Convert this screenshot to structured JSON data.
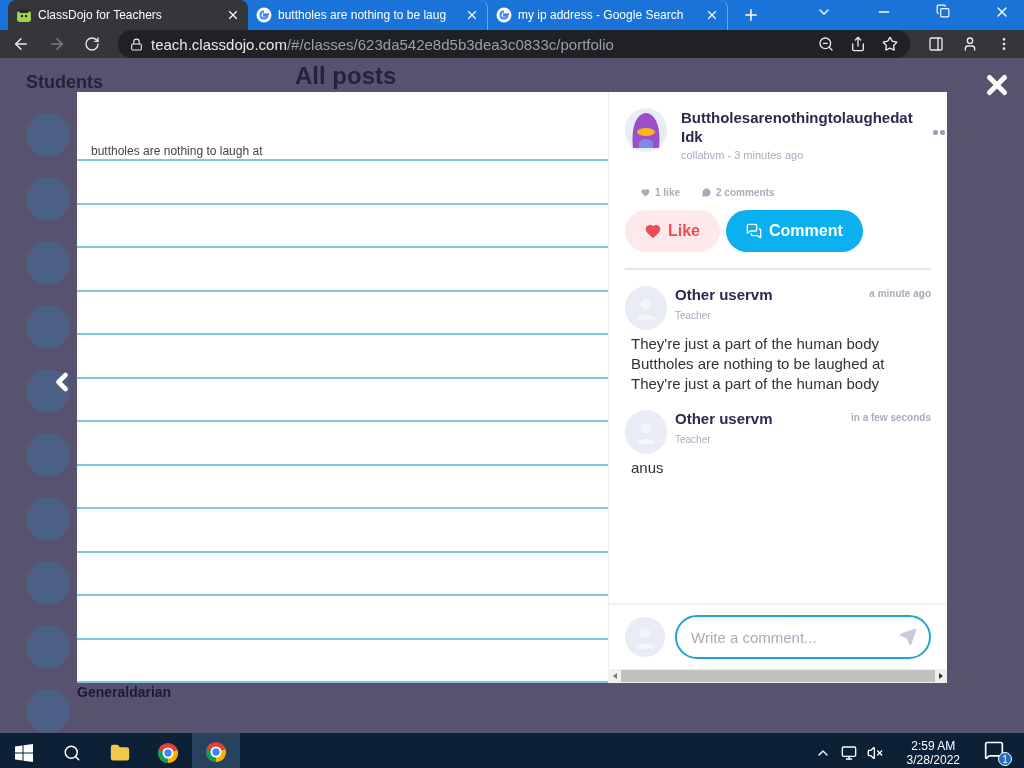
{
  "browser": {
    "tabs": [
      {
        "title": "ClassDojo for Teachers",
        "selected": true,
        "kind": "dojo"
      },
      {
        "title": "buttholes are nothing to be laug",
        "selected": false,
        "kind": "google"
      },
      {
        "title": "my ip address - Google Search",
        "selected": false,
        "kind": "google"
      }
    ],
    "url": {
      "host": "teach.classdojo.com",
      "path": "/#/classes/623da542e8d5b3dea3c0833c/portfolio"
    }
  },
  "background": {
    "sidebar_title": "Students",
    "heading": "All posts",
    "student_name": "Generaldarian"
  },
  "post": {
    "note": "buttholes are nothing to laugh at",
    "title": "Buttholesarenothingtolaughedat Idk",
    "meta": "collabvm - 3 minutes ago",
    "likes": "1 like",
    "comments_count": "2 comments",
    "liked": false,
    "like_button": "Like",
    "comment_button": "Comment",
    "comments": [
      {
        "author": "Other uservm",
        "role": "Teacher",
        "time": "a minute ago",
        "lines": [
          "They're just a part of the human body",
          "Buttholes are nothing to be laughed at",
          "They're just a part of the human body"
        ]
      },
      {
        "author": "Other uservm",
        "role": "Teacher",
        "time": "in a few seconds",
        "lines": [
          "anus"
        ]
      }
    ],
    "comment_placeholder": "Write a comment..."
  },
  "taskbar": {
    "time": "2:59 AM",
    "date": "3/28/2022",
    "notifications": "1"
  }
}
